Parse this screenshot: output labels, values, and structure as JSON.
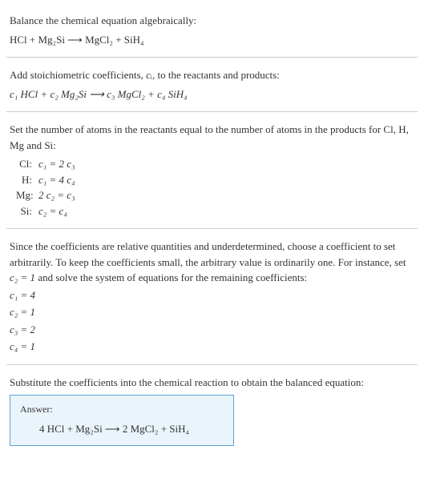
{
  "section1": {
    "heading": "Balance the chemical equation algebraically:",
    "equation": "HCl + Mg₂Si  ⟶  MgCl₂ + SiH₄"
  },
  "section2": {
    "text_before": "Add stoichiometric coefficients, ",
    "ci": "cᵢ",
    "text_after": ", to the reactants and products:",
    "equation": "c₁ HCl + c₂ Mg₂Si  ⟶  c₃ MgCl₂ + c₄ SiH₄"
  },
  "section3": {
    "heading": "Set the number of atoms in the reactants equal to the number of atoms in the products for Cl, H, Mg and Si:",
    "rows": [
      {
        "label": "Cl:",
        "eq": "c₁ = 2 c₃"
      },
      {
        "label": "H:",
        "eq": "c₁ = 4 c₄"
      },
      {
        "label": "Mg:",
        "eq": "2 c₂ = c₃"
      },
      {
        "label": "Si:",
        "eq": "c₂ = c₄"
      }
    ]
  },
  "section4": {
    "text1": "Since the coefficients are relative quantities and underdetermined, choose a coefficient to set arbitrarily. To keep the coefficients small, the arbitrary value is ordinarily one. For instance, set ",
    "cval": "c₂ = 1",
    "text2": " and solve the system of equations for the remaining coefficients:",
    "coeffs": [
      "c₁ = 4",
      "c₂ = 1",
      "c₃ = 2",
      "c₄ = 1"
    ]
  },
  "section5": {
    "heading": "Substitute the coefficients into the chemical reaction to obtain the balanced equation:",
    "answer_label": "Answer:",
    "answer_equation": "4 HCl + Mg₂Si  ⟶  2 MgCl₂ + SiH₄"
  }
}
